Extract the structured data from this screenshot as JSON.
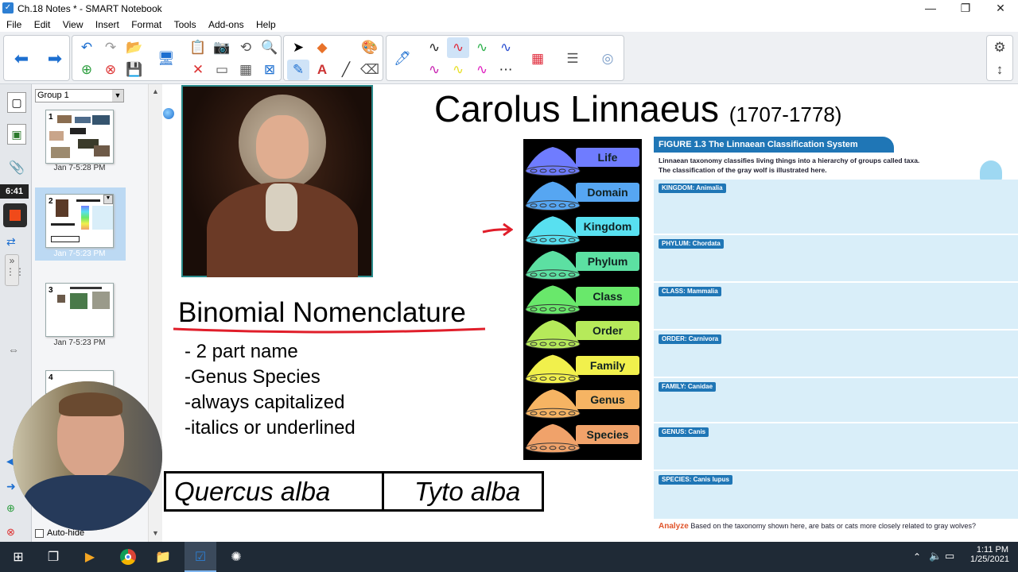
{
  "window": {
    "title": "Ch.18 Notes * - SMART Notebook"
  },
  "menu": [
    "File",
    "Edit",
    "View",
    "Insert",
    "Format",
    "Tools",
    "Add-ons",
    "Help"
  ],
  "sidebar": {
    "group_label": "Group 1",
    "thumbs": [
      {
        "num": "1",
        "caption": "Jan 7-5:28 PM"
      },
      {
        "num": "2",
        "caption": "Jan 7-5:23 PM"
      },
      {
        "num": "3",
        "caption": "Jan 7-5:23 PM"
      },
      {
        "num": "4",
        "caption": ""
      }
    ],
    "autohide": "Auto-hide",
    "timer": "6:41"
  },
  "slide": {
    "title": "Carolus Linnaeus",
    "dates": "(1707-1778)",
    "binomial_heading": "Binomial Nomenclature",
    "bullets": [
      "- 2 part name",
      "-Genus Species",
      "-always capitalized",
      "-italics or underlined"
    ],
    "example_left": "Quercus alba",
    "example_right": "Tyto alba",
    "pyramid": [
      {
        "label": "Life",
        "color": "#6f7cff"
      },
      {
        "label": "Domain",
        "color": "#56a6f2"
      },
      {
        "label": "Kingdom",
        "color": "#58e0f0"
      },
      {
        "label": "Phylum",
        "color": "#5ce0a2"
      },
      {
        "label": "Class",
        "color": "#69e86b"
      },
      {
        "label": "Order",
        "color": "#b6ea5a"
      },
      {
        "label": "Family",
        "color": "#f1f04c"
      },
      {
        "label": "Genus",
        "color": "#f6b463"
      },
      {
        "label": "Species",
        "color": "#f0a26a"
      }
    ],
    "figure": {
      "header": "FIGURE 1.3  The Linnaean Classification System",
      "intro1": "Linnaean taxonomy classifies living things into a hierarchy of groups called taxa.",
      "intro2": "The classification of the gray wolf is illustrated here.",
      "rows": [
        "KINGDOM: Animalia",
        "PHYLUM: Chordata",
        "CLASS: Mammalia",
        "ORDER: Carnivora",
        "FAMILY: Canidae",
        "GENUS: Canis",
        "SPECIES: Canis lupus"
      ],
      "analyze_label": "Analyze",
      "analyze_text": "Based on the taxonomy shown here, are bats or cats more closely related to gray wolves?"
    }
  },
  "taskbar": {
    "time": "1:11 PM",
    "date": "1/25/2021"
  }
}
